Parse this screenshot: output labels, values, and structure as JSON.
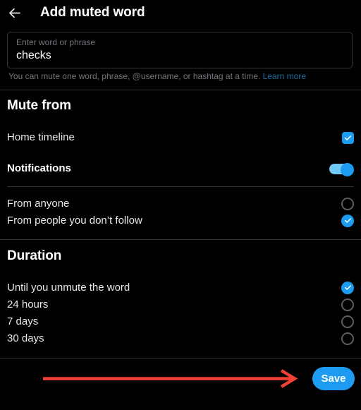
{
  "header": {
    "back_icon": "arrow-left-icon",
    "title": "Add muted word"
  },
  "input": {
    "label": "Enter word or phrase",
    "value": "checks",
    "placeholder": "Enter word or phrase",
    "help_text": "You can mute one word, phrase, @username, or hashtag at a time.",
    "help_link": "Learn more"
  },
  "mute_from": {
    "title": "Mute from",
    "home_timeline": {
      "label": "Home timeline",
      "control": "checkbox",
      "checked": true
    },
    "notifications": {
      "label": "Notifications",
      "control": "toggle",
      "enabled": true
    },
    "audience": [
      {
        "label": "From anyone",
        "selected": false
      },
      {
        "label": "From people you don’t follow",
        "selected": true
      }
    ]
  },
  "duration": {
    "title": "Duration",
    "options": [
      {
        "label": "Until you unmute the word",
        "selected": true
      },
      {
        "label": "24 hours",
        "selected": false
      },
      {
        "label": "7 days",
        "selected": false
      },
      {
        "label": "30 days",
        "selected": false
      }
    ]
  },
  "footer": {
    "save_label": "Save",
    "annotation": "red-arrow-pointing-to-save"
  },
  "colors": {
    "accent_blue": "#1d9bf0",
    "toggle_track": "#71c9f8",
    "background": "#000000",
    "divider": "#2f3336",
    "muted_text": "#71767b",
    "link_blue": "#1d6fa3",
    "annotation_red": "#ef4136"
  }
}
